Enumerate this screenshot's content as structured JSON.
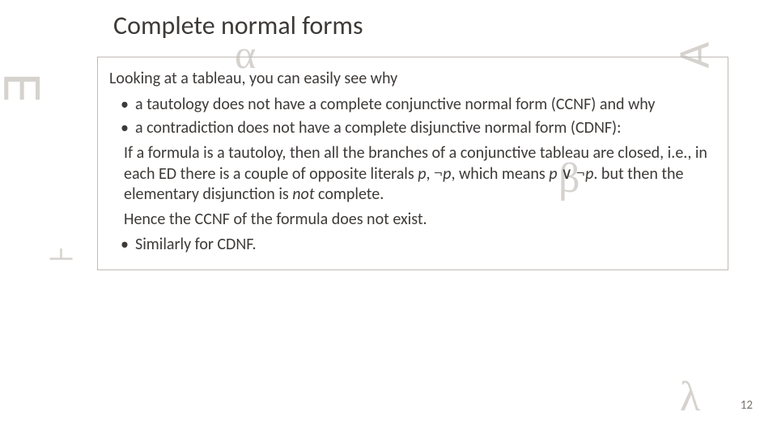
{
  "slide": {
    "title": "Complete normal forms",
    "page_number": "12"
  },
  "decor": {
    "exists": "∃",
    "alpha": "α",
    "forall": "∀",
    "beta": "β",
    "turnstile": "⊦",
    "lambda": "λ"
  },
  "content": {
    "intro": "Looking at a tableau, you can easily see why",
    "bullets_top": [
      "a tautology does not have a complete conjunctive normal form (CCNF) and why",
      "a contradiction does not have a complete disjunctive normal form (CDNF):"
    ],
    "explanation_pre": "If a formula is a tautoloy, then all the branches of a conjunctive tableau are closed, i.e., in each ED there is a couple of opposite literals ",
    "lit_p": "p",
    "comma_sep": ", ",
    "neg": "¬",
    "lit_p2": "p",
    "explanation_mid": ", which means ",
    "formula_p": "p",
    "or": " ∨ ",
    "formula_notp": "p",
    "explanation_post1": ". but then the elementary disjunction is ",
    "not_word": "not",
    "explanation_post2": " complete.",
    "hence": "Hence the CCNF of the formula does not exist.",
    "bullets_bottom": [
      "Similarly for CDNF."
    ]
  }
}
